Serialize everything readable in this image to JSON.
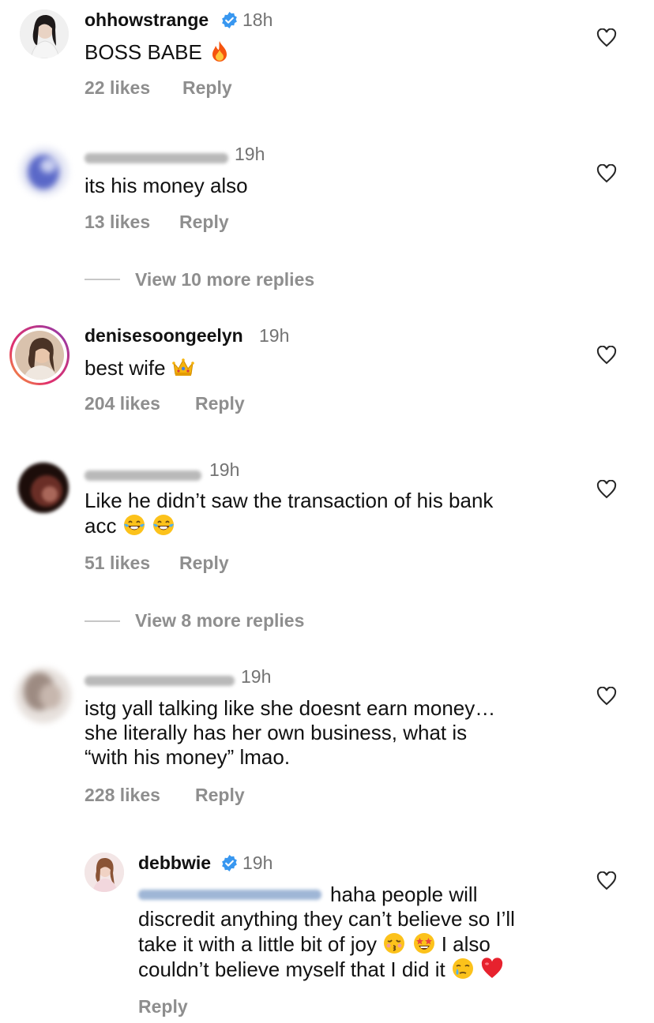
{
  "comments": [
    {
      "username": "ohhowstrange",
      "verified": true,
      "time": "18h",
      "text": "BOSS BABE",
      "emoji": [
        "fire-emoji"
      ],
      "likes": "22 likes",
      "reply": "Reply"
    },
    {
      "username": "",
      "username_hidden": true,
      "time": "19h",
      "text": "its his money also",
      "likes": "13 likes",
      "reply": "Reply",
      "view_replies": "View 10 more replies"
    },
    {
      "username": "denisesoongeelyn",
      "has_story_ring": true,
      "time": "19h",
      "text": "best wife",
      "emoji": [
        "crown-emoji"
      ],
      "likes": "204 likes",
      "reply": "Reply"
    },
    {
      "username": "",
      "username_hidden": true,
      "time": "19h",
      "text_line1": "Like he didn’t saw the transaction of his bank",
      "text_line2": "acc",
      "emoji": [
        "joy-emoji",
        "joy-emoji"
      ],
      "likes": "51 likes",
      "reply": "Reply",
      "view_replies": "View 8 more replies"
    },
    {
      "username": "",
      "username_hidden": true,
      "time": "19h",
      "text_line1": "istg yall talking like she doesnt earn money…",
      "text_line2": "she literally has her own business, what is",
      "text_line3": "“with his money” lmao.",
      "likes": "228 likes",
      "reply": "Reply"
    }
  ],
  "reply": {
    "username": "debbwie",
    "verified": true,
    "time": "19h",
    "mention_hidden": true,
    "text_line1": "haha people will",
    "text_line2": "discredit anything they can’t believe so I’ll",
    "text_line3a": "take it with a little bit of joy",
    "text_line3b": "I also",
    "text_line4": "couldn’t believe myself that I did it",
    "emoji": [
      "kissing-closed-eyes-emoji",
      "star-struck-emoji",
      "sad-relieved-emoji",
      "red-heart-emoji"
    ],
    "reply": "Reply"
  },
  "colors": {
    "text": "#111111",
    "secondary": "#8e8e8e",
    "verified": "#3897f0"
  }
}
